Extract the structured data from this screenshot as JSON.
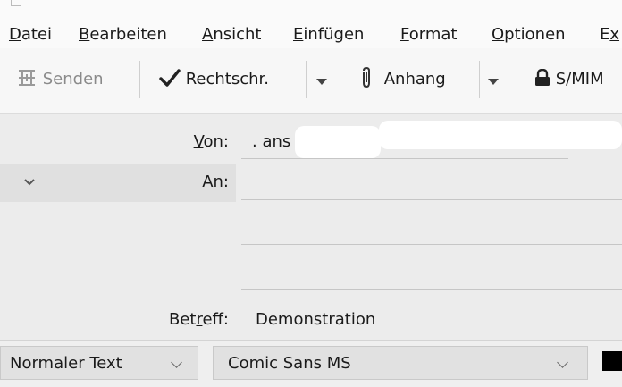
{
  "menu": {
    "items": [
      {
        "label": "Datei"
      },
      {
        "label": "Bearbeiten"
      },
      {
        "label": "Ansicht"
      },
      {
        "label": "Einfügen"
      },
      {
        "label": "Format"
      },
      {
        "label": "Optionen"
      },
      {
        "label": "Ex"
      }
    ]
  },
  "toolbar": {
    "send_label": "Senden",
    "spell_label": "Rechtschr.",
    "attach_label": "Anhang",
    "smime_label": "S/MIM",
    "icons": [
      "send-icon",
      "checkmark-icon",
      "paperclip-icon",
      "lock-icon",
      "dropdown-arrow-icon"
    ]
  },
  "header": {
    "from_label": "Von:",
    "from_value": ". ans L",
    "to_label": "An:",
    "subject_label": "Betreff:",
    "subject_value": "Demonstration"
  },
  "formatbar": {
    "paragraph_style": "Normaler Text",
    "font_family": "Comic Sans MS",
    "text_color": "#000000"
  }
}
